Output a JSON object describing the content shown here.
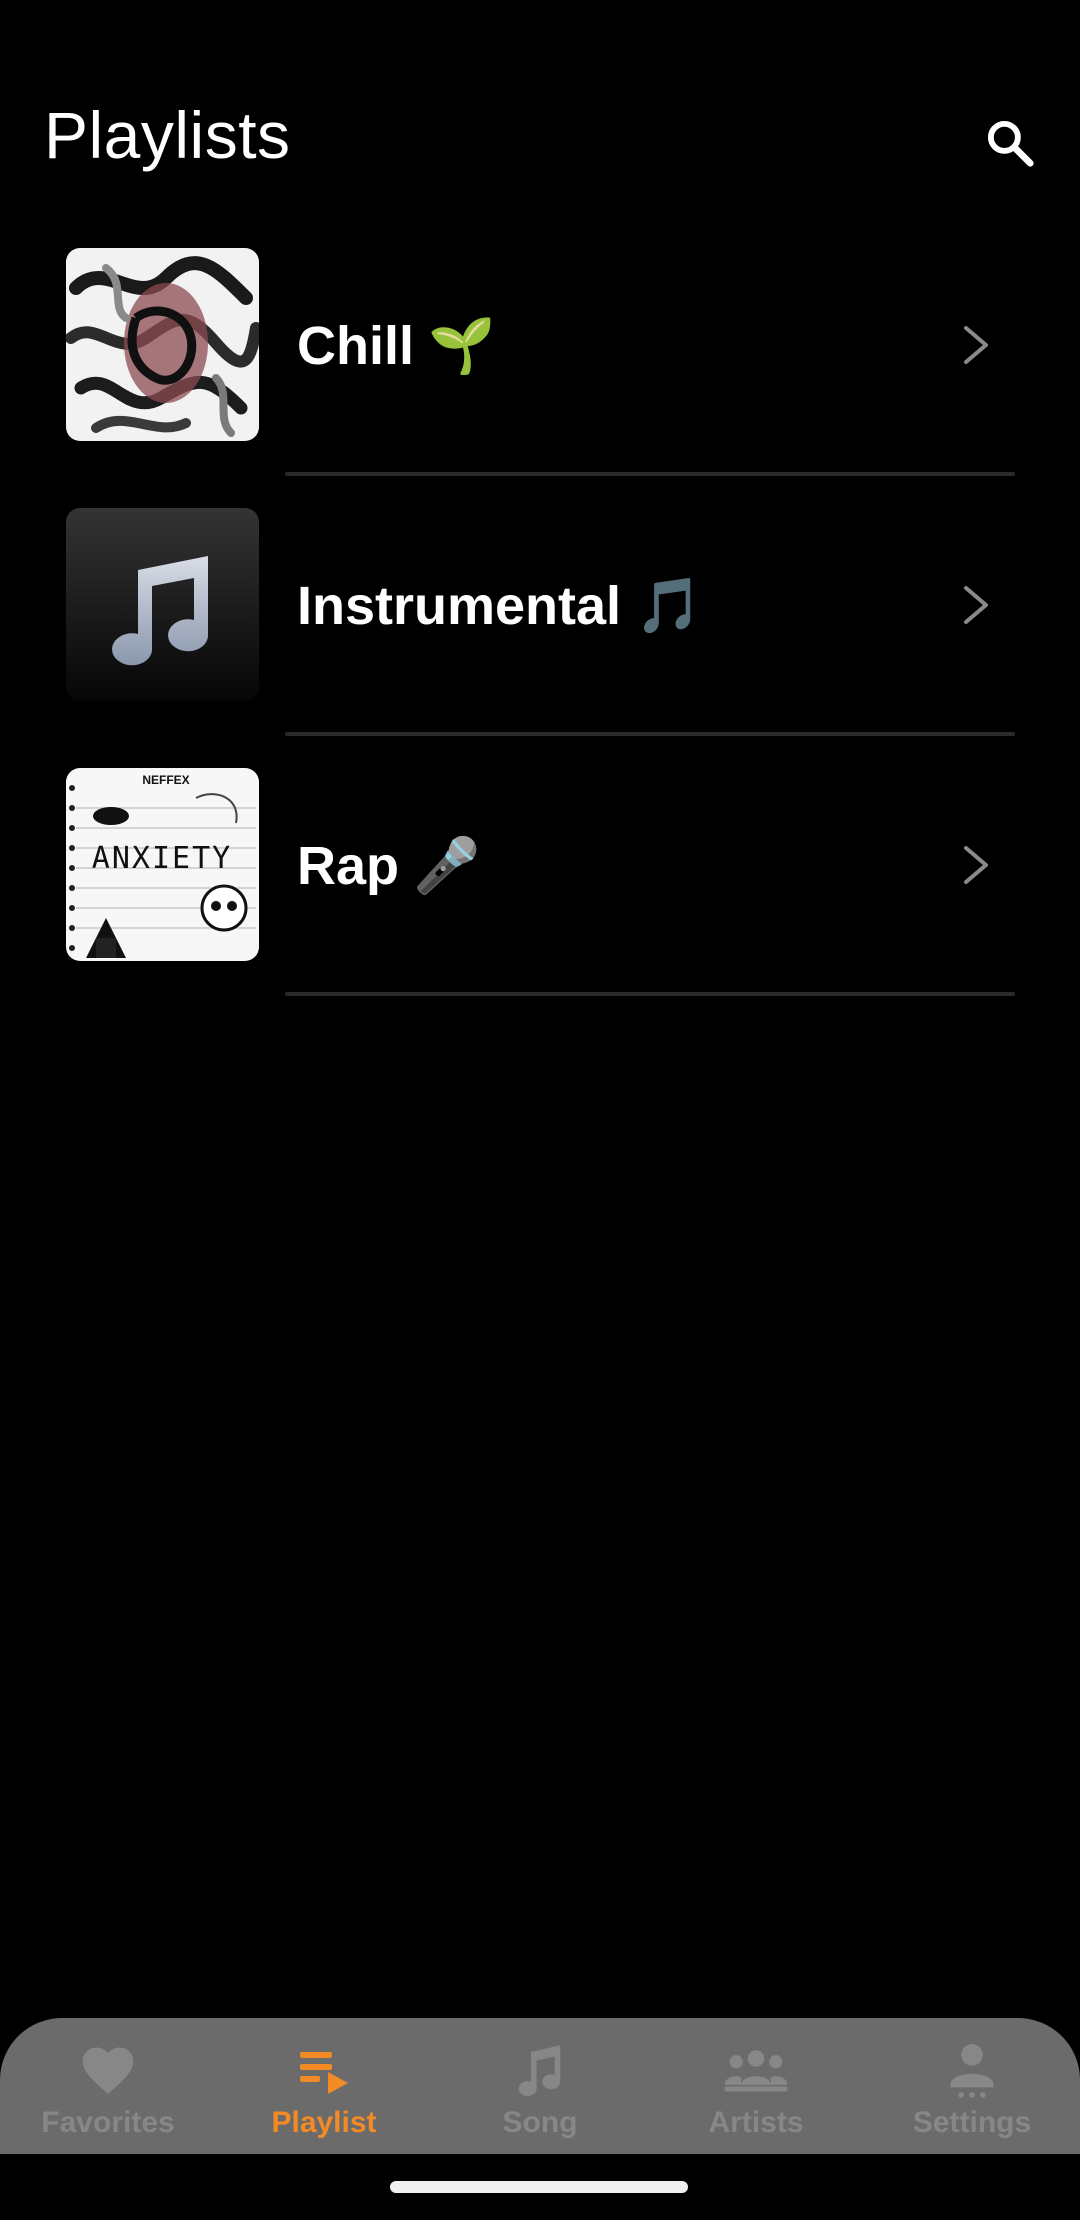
{
  "header": {
    "title": "Playlists",
    "search_icon": "search-icon"
  },
  "playlists": [
    {
      "name": "Chill",
      "emoji": "🌱",
      "cover_icon": "abstract-art-cover"
    },
    {
      "name": "Instrumental",
      "emoji": "🎵",
      "cover_icon": "music-note-cover"
    },
    {
      "name": "Rap",
      "emoji": "🎤",
      "cover_icon": "anxiety-album-cover",
      "cover_text": "ANXIETY",
      "cover_subtext": "NEFFEX"
    }
  ],
  "bottom_nav": {
    "items": [
      {
        "label": "Favorites",
        "icon": "heart-icon"
      },
      {
        "label": "Playlist",
        "icon": "playlist-icon"
      },
      {
        "label": "Song",
        "icon": "music-note-icon"
      },
      {
        "label": "Artists",
        "icon": "people-icon"
      },
      {
        "label": "Settings",
        "icon": "person-icon"
      }
    ],
    "active_label": "Playlist"
  },
  "colors": {
    "background": "#000000",
    "accent": "#f28a25",
    "nav_bg": "#6b6b6b",
    "nav_inactive": "#878787",
    "divider": "#2a2a2a"
  }
}
